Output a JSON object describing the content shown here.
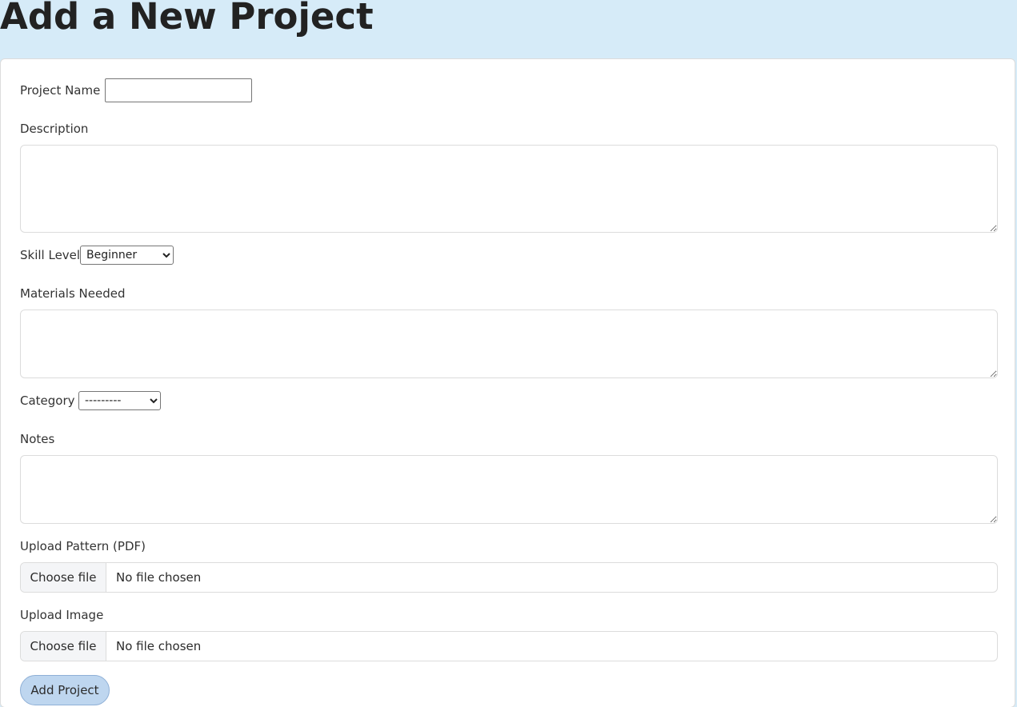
{
  "page": {
    "title": "Add a New Project"
  },
  "form": {
    "project_name": {
      "label": "Project Name",
      "value": ""
    },
    "description": {
      "label": "Description",
      "value": ""
    },
    "skill_level": {
      "label": "Skill Level",
      "selected": "Beginner"
    },
    "materials_needed": {
      "label": "Materials Needed",
      "value": ""
    },
    "category": {
      "label": "Category",
      "selected": "---------"
    },
    "notes": {
      "label": "Notes",
      "value": ""
    },
    "upload_pattern": {
      "label": "Upload Pattern (PDF)",
      "button_label": "Choose file",
      "status": "No file chosen"
    },
    "upload_image": {
      "label": "Upload Image",
      "button_label": "Choose file",
      "status": "No file chosen"
    },
    "submit_label": "Add Project"
  },
  "colors": {
    "header_background": "#d6ebf8",
    "submit_background": "#bed6ef",
    "submit_border": "#8fb0d6"
  }
}
